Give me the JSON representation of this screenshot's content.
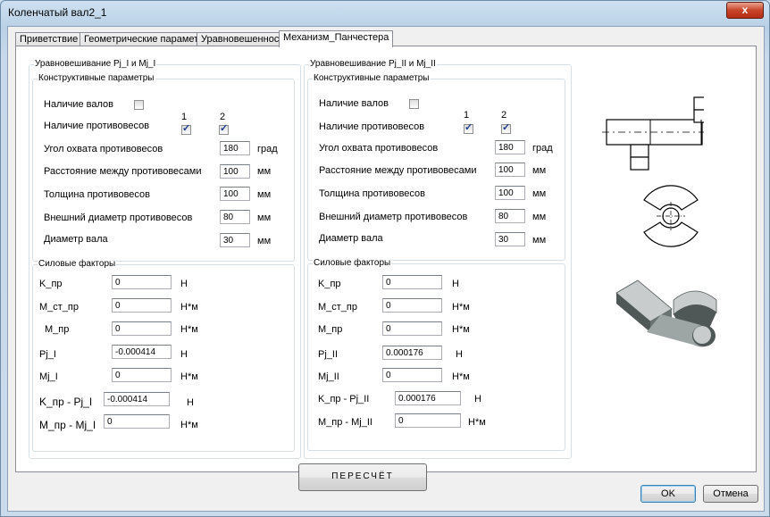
{
  "window": {
    "title": "Коленчатый вал2_1",
    "close_glyph": "x"
  },
  "tabs": [
    {
      "label": "Приветствие"
    },
    {
      "label": "Геометрические параметры"
    },
    {
      "label": "Уравновешенность"
    },
    {
      "label": "Механизм_Панчестера"
    }
  ],
  "left": {
    "group_title": "Уравновешивание Pj_I и Mj_I",
    "constructive": {
      "title": "Конструктивные параметры",
      "shafts_label": "Наличие валов",
      "shafts_checked": false,
      "counterweights_label": "Наличие противовесов",
      "col1": "1",
      "col2": "2",
      "cw1_checked": true,
      "cw2_checked": true,
      "rows": [
        {
          "label": "Угол охвата противовесов",
          "value": "180",
          "unit": "град"
        },
        {
          "label": "Расстояние между противовесами",
          "value": "100",
          "unit": "мм"
        },
        {
          "label": "Толщина противовесов",
          "value": "100",
          "unit": "мм"
        },
        {
          "label": "Внешний диаметр противовесов",
          "value": "80",
          "unit": "мм"
        },
        {
          "label": "Диаметр вала",
          "value": "30",
          "unit": "мм"
        }
      ]
    },
    "forces": {
      "title": "Силовые факторы",
      "rows": [
        {
          "label": "K_пр",
          "value": "0",
          "unit": "Н"
        },
        {
          "label": "M_ст_пр",
          "value": "0",
          "unit": "Н*м"
        },
        {
          "label": "M_пр",
          "value": "0",
          "unit": "Н*м"
        },
        {
          "label": "Pj_I",
          "value": "-0.000414",
          "unit": "Н"
        },
        {
          "label": "Mj_I",
          "value": "0",
          "unit": "Н*м"
        },
        {
          "label": "K_пр - Pj_I",
          "value": "-0.000414",
          "unit": "Н"
        },
        {
          "label": "M_пр - Mj_I",
          "value": "0",
          "unit": "Н*м"
        }
      ]
    }
  },
  "right": {
    "group_title": "Уравновешивание Pj_II и Mj_II",
    "constructive": {
      "title": "Конструктивные параметры",
      "shafts_label": "Наличие валов",
      "shafts_checked": false,
      "counterweights_label": "Наличие противовесов",
      "col1": "1",
      "col2": "2",
      "cw1_checked": true,
      "cw2_checked": true,
      "rows": [
        {
          "label": "Угол охвата противовесов",
          "value": "180",
          "unit": "град"
        },
        {
          "label": "Расстояние между противовесами",
          "value": "100",
          "unit": "мм"
        },
        {
          "label": "Толщина противовесов",
          "value": "100",
          "unit": "мм"
        },
        {
          "label": "Внешний диаметр противовесов",
          "value": "80",
          "unit": "мм"
        },
        {
          "label": "Диаметр вала",
          "value": "30",
          "unit": "мм"
        }
      ]
    },
    "forces": {
      "title": "Силовые факторы",
      "rows": [
        {
          "label": "K_пр",
          "value": "0",
          "unit": "Н"
        },
        {
          "label": "M_ст_пр",
          "value": "0",
          "unit": "Н*м"
        },
        {
          "label": "M_пр",
          "value": "0",
          "unit": "Н*м"
        },
        {
          "label": "Pj_II",
          "value": "0.000176",
          "unit": "Н"
        },
        {
          "label": "Mj_II",
          "value": "0",
          "unit": "Н*м"
        },
        {
          "label": "K_пр - Pj_II",
          "value": "0.000176",
          "unit": "Н"
        },
        {
          "label": "M_пр - Mj_II",
          "value": "0",
          "unit": "Н*м"
        }
      ]
    }
  },
  "recalc_label": "ПЕРЕСЧЁТ",
  "ok_label": "OK",
  "cancel_label": "Отмена",
  "colors": {
    "accent": "#3c7fb1",
    "part_face": "#c8cccc",
    "part_dark": "#4f5757"
  }
}
